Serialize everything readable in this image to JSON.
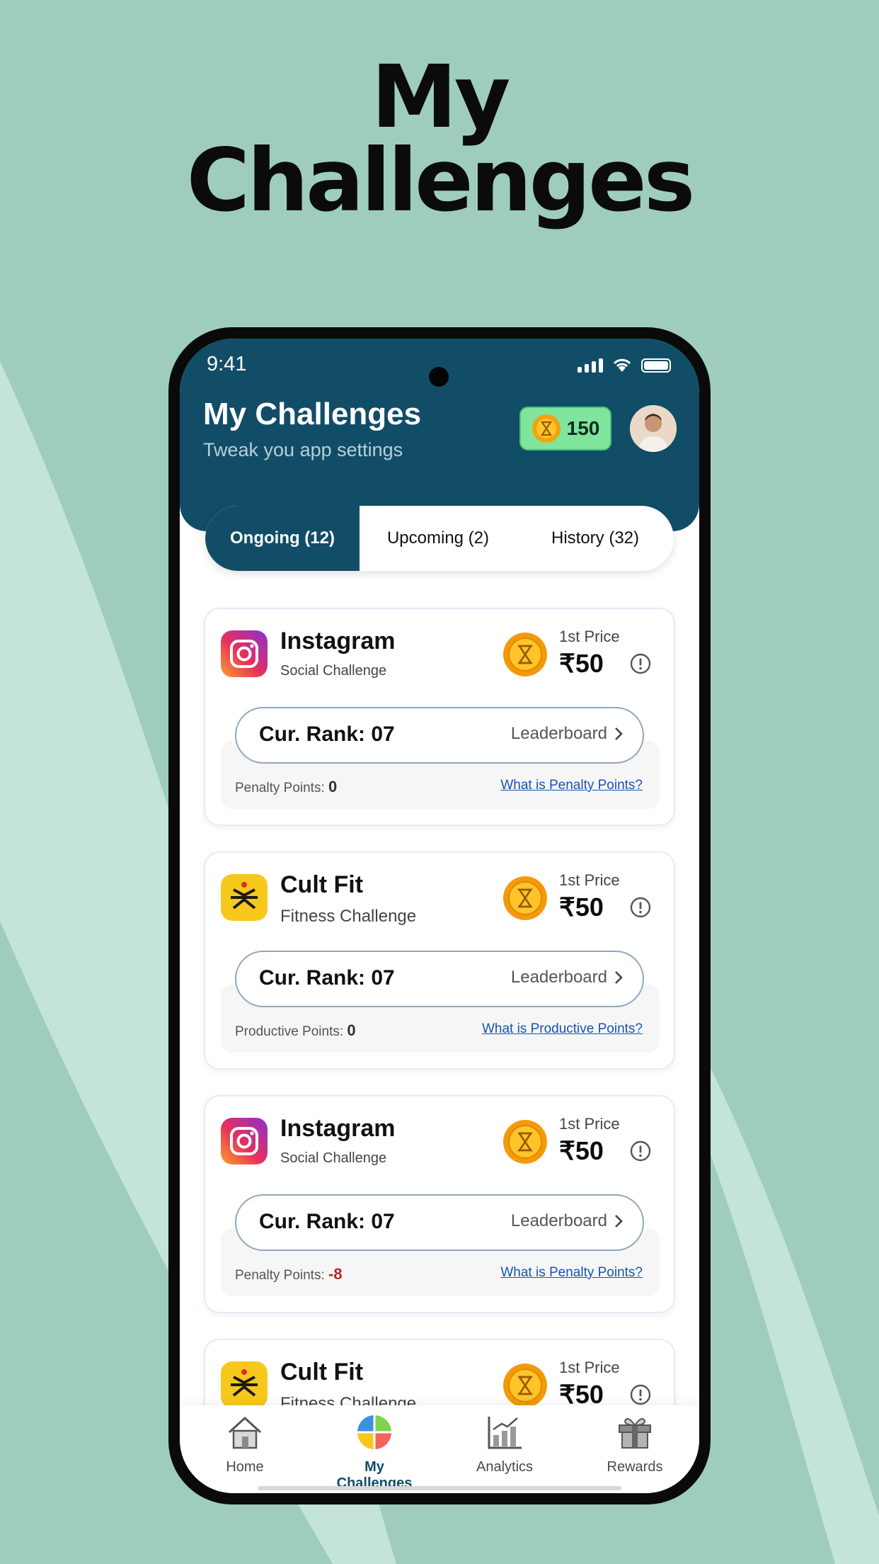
{
  "promo": {
    "title_line1": "My",
    "title_line2": "Challenges"
  },
  "status_bar": {
    "time": "9:41"
  },
  "header": {
    "title": "My Challenges",
    "subtitle": "Tweak you app settings",
    "coin_balance": "150"
  },
  "tabs": [
    {
      "label": "Ongoing (12)",
      "active": true
    },
    {
      "label": "Upcoming (2)",
      "active": false
    },
    {
      "label": "History (32)",
      "active": false
    }
  ],
  "cards": [
    {
      "app": "Instagram",
      "type": "Social Challenge",
      "prize_label": "1st Price",
      "prize": "₹50",
      "rank": "Cur. Rank: 07",
      "leaderboard": "Leaderboard",
      "points_label": "Penalty Points:",
      "points_value": "0",
      "help_link": "What is Penalty Points?"
    },
    {
      "app": "Cult Fit",
      "type": "Fitness Challenge",
      "prize_label": "1st Price",
      "prize": "₹50",
      "rank": "Cur. Rank: 07",
      "leaderboard": "Leaderboard",
      "points_label": "Productive Points:",
      "points_value": "0",
      "help_link": "What is Productive Points?"
    },
    {
      "app": "Instagram",
      "type": "Social Challenge",
      "prize_label": "1st Price",
      "prize": "₹50",
      "rank": "Cur. Rank: 07",
      "leaderboard": "Leaderboard",
      "points_label": "Penalty Points:",
      "points_value": "-8",
      "help_link": "What is Penalty Points?"
    },
    {
      "app": "Cult Fit",
      "type": "Fitness Challenge",
      "prize_label": "1st Price",
      "prize": "₹50"
    }
  ],
  "bottom_nav": [
    {
      "label": "Home",
      "icon": "home-icon",
      "active": false
    },
    {
      "label": "My Challenges",
      "icon": "challenges-icon",
      "active": true
    },
    {
      "label": "Analytics",
      "icon": "analytics-icon",
      "active": false
    },
    {
      "label": "Rewards",
      "icon": "rewards-icon",
      "active": false
    }
  ],
  "colors": {
    "background": "#9fcdbd",
    "header": "#124d67",
    "coin_pill": "#7fe59d",
    "link": "#1555b3",
    "negative": "#b02a2a"
  }
}
